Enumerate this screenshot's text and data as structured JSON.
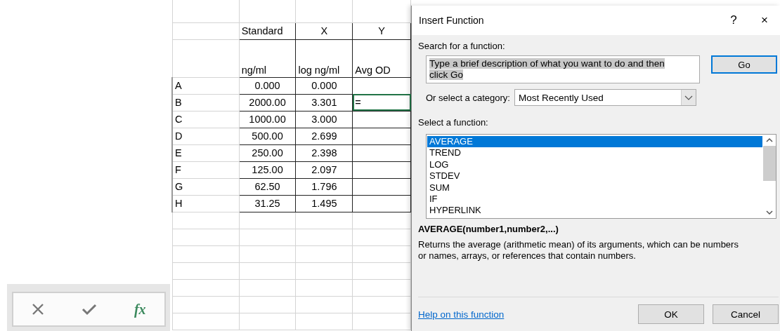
{
  "formula_bar": {
    "function_label": "fx"
  },
  "sheet": {
    "header": [
      "Standard",
      "X",
      "Y"
    ],
    "units": [
      "ng/ml",
      "log ng/ml",
      "Avg OD"
    ],
    "rows": [
      {
        "label": "A",
        "conc": "0.000",
        "log": "0.000",
        "selected": false
      },
      {
        "label": "B",
        "conc": "2000.00",
        "log": "3.301",
        "avg_od": "=",
        "selected": true
      },
      {
        "label": "C",
        "conc": "1000.00",
        "log": "3.000",
        "selected": false
      },
      {
        "label": "D",
        "conc": "500.00",
        "log": "2.699",
        "selected": false
      },
      {
        "label": "E",
        "conc": "250.00",
        "log": "2.398",
        "selected": false
      },
      {
        "label": "F",
        "conc": "125.00",
        "log": "2.097",
        "selected": false
      },
      {
        "label": "G",
        "conc": "62.50",
        "log": "1.796",
        "selected": false
      },
      {
        "label": "H",
        "conc": "31.25",
        "log": "1.495",
        "selected": false
      }
    ]
  },
  "dialog": {
    "title": "Insert Function",
    "help_button": "?",
    "close_button": "×",
    "search_label": "Search for a function:",
    "search": {
      "value": "Type a brief description of what you want to do and then click Go",
      "text_selected": true
    },
    "go_button": {
      "label": "Go",
      "default": true
    },
    "category_label": "Or select a category:",
    "category": "Most Recently Used",
    "function_label": "Select a function:",
    "functions": [
      {
        "name": "AVERAGE",
        "selected": true
      },
      {
        "name": "TREND",
        "selected": false
      },
      {
        "name": "LOG",
        "selected": false
      },
      {
        "name": "STDEV",
        "selected": false
      },
      {
        "name": "SUM",
        "selected": false
      },
      {
        "name": "IF",
        "selected": false
      },
      {
        "name": "HYPERLINK",
        "selected": false
      }
    ],
    "signature": "AVERAGE(number1,number2,...)",
    "description": "Returns the average (arithmetic mean) of its arguments, which can be numbers or names, arrays, or references that contain numbers.",
    "help_link": "Help on this function",
    "buttons": [
      "OK",
      "Cancel"
    ]
  }
}
